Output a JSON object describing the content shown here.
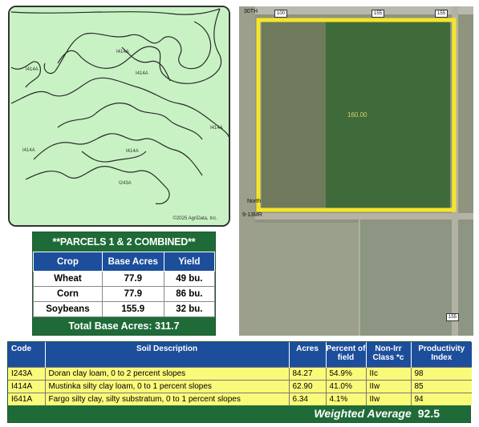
{
  "soil_map": {
    "labels": {
      "l1": "I414A",
      "l2": "I414A",
      "l3": "I414A",
      "l4": "I414A",
      "l5": "I414A",
      "l6": "I414A",
      "l7": "I243A"
    },
    "copyright": "©2025 AgriData, Inc."
  },
  "aerial": {
    "acre_label": "160.00",
    "roads": {
      "r1": "30TH",
      "r2": "North",
      "r3": "9-13MR",
      "r4": "155"
    },
    "signs": {
      "s1": "100",
      "s2": "155",
      "s3": "155",
      "s4": "155"
    },
    "boundary_color": "#f5e52a"
  },
  "parcels": {
    "title": "**PARCELS 1 & 2 COMBINED**",
    "headers": [
      "Crop",
      "Base Acres",
      "Yield"
    ],
    "rows": [
      {
        "crop": "Wheat",
        "acres": "77.9",
        "yield": "49 bu."
      },
      {
        "crop": "Corn",
        "acres": "77.9",
        "yield": "86 bu."
      },
      {
        "crop": "Soybeans",
        "acres": "155.9",
        "yield": "32 bu."
      }
    ],
    "total_label": "Total Base Acres:",
    "total_value": "311.7"
  },
  "soil_table": {
    "headers": {
      "code": "Code",
      "desc": "Soil Description",
      "acres": "Acres",
      "percent": "Percent of field",
      "class": "Non-Irr Class *c",
      "pi": "Productivity Index"
    },
    "rows": [
      {
        "code": "I243A",
        "desc": "Doran clay loam, 0 to 2 percent slopes",
        "acres": "84.27",
        "percent": "54.9%",
        "class": "IIc",
        "pi": "98"
      },
      {
        "code": "I414A",
        "desc": "Mustinka silty clay loam, 0 to 1 percent slopes",
        "acres": "62.90",
        "percent": "41.0%",
        "class": "IIw",
        "pi": "85"
      },
      {
        "code": "I641A",
        "desc": "Fargo silty clay, silty substratum, 0 to 1 percent slopes",
        "acres": "6.34",
        "percent": "4.1%",
        "class": "IIw",
        "pi": "94"
      }
    ],
    "avg_label": "Weighted Average",
    "avg_value": "92.5"
  },
  "colors": {
    "map_fill": "#c9f2c4",
    "header_blue": "#1c4e9c",
    "header_green": "#1f6b38",
    "row_yellow": "#fafa7a"
  }
}
